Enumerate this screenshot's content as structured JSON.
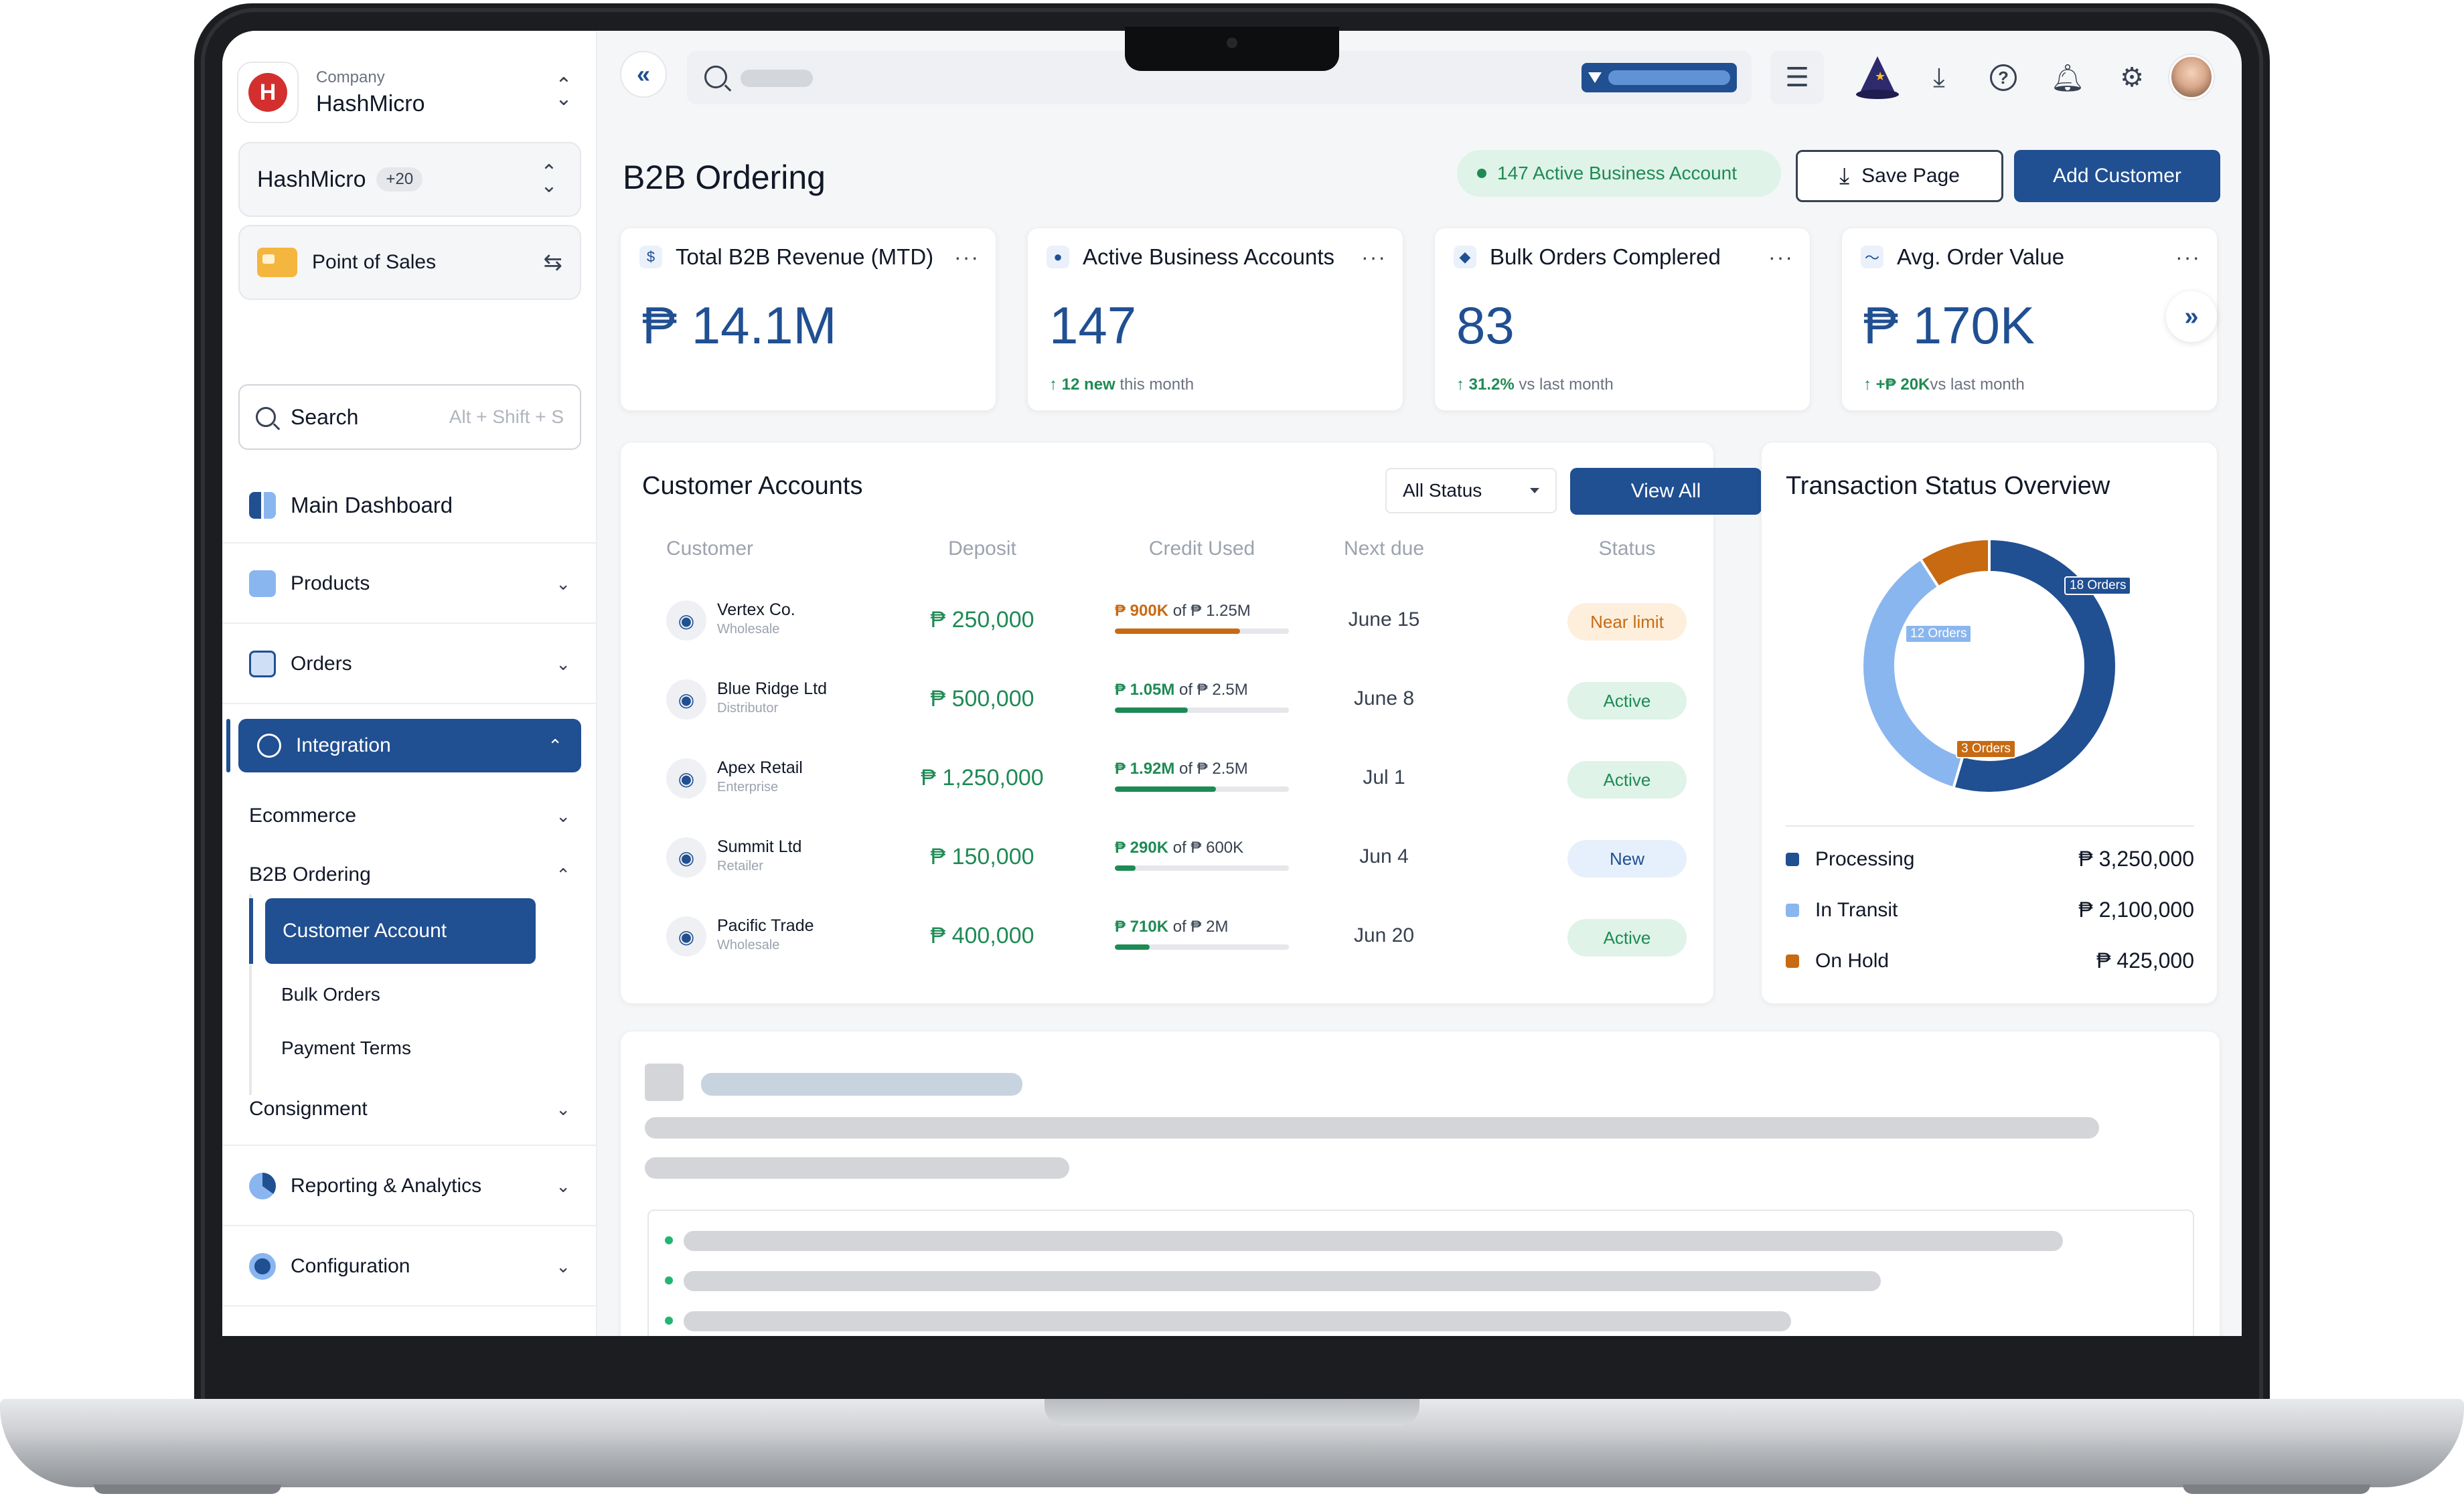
{
  "colors": {
    "brand": "#204f92",
    "success": "#1f8a55",
    "warning": "#c76a12",
    "processing": "#204f92",
    "in_transit": "#8ab6ef",
    "on_hold": "#c76a12"
  },
  "sidebar": {
    "company_label": "Company",
    "company_name": "HashMicro",
    "brand_name": "HashMicro",
    "brand_count": "+20",
    "module_name": "Point of Sales",
    "search_label": "Search",
    "search_shortcut": "Alt + Shift + S",
    "nav": {
      "main_dashboard": "Main Dashboard",
      "products": "Products",
      "orders": "Orders",
      "integration": "Integration",
      "ecommerce": "Ecommerce",
      "b2b_ordering": "B2B Ordering",
      "customer_account": "Customer Account",
      "bulk_orders": "Bulk Orders",
      "payment_terms": "Payment Terms",
      "consignment": "Consignment",
      "reporting": "Reporting & Analytics",
      "configuration": "Configuration"
    }
  },
  "header": {
    "icons": [
      "collapse-icon",
      "search-icon",
      "filter-icon",
      "sliders-icon",
      "wizard-icon",
      "download-icon",
      "help-icon",
      "bell-icon",
      "gear-icon"
    ]
  },
  "page": {
    "title": "B2B Ordering",
    "active_pill": "147 Active Business Account",
    "save_button": "Save Page",
    "add_button": "Add Customer"
  },
  "kpis": [
    {
      "title": "Total B2B Revenue (MTD)",
      "value": "₱ 14.1M",
      "delta_strong": "",
      "delta_text": ""
    },
    {
      "title": "Active Business Accounts",
      "value": "147",
      "delta_strong": "↑ 12 new",
      "delta_text": " this month"
    },
    {
      "title": "Bulk Orders Complered",
      "value": "83",
      "delta_strong": "↑ 31.2%",
      "delta_text": " vs last month"
    },
    {
      "title": "Avg. Order Value",
      "value": "₱ 170K",
      "delta_strong": "↑ +₱ 20K",
      "delta_text": "vs last month"
    }
  ],
  "customers": {
    "title": "Customer Accounts",
    "filter_value": "All Status",
    "view_all": "View All",
    "columns": [
      "Customer",
      "Deposit",
      "Credit Used",
      "Next due",
      "Status"
    ],
    "rows": [
      {
        "name": "Vertex Co.",
        "type": "Wholesale",
        "deposit": "₱ 250,000",
        "used": "₱ 900K",
        "limit": " of ₱ 1.25M",
        "pct": 0.72,
        "due": "June 15",
        "status": "Near limit",
        "tone": "warn"
      },
      {
        "name": "Blue Ridge Ltd",
        "type": "Distributor",
        "deposit": "₱ 500,000",
        "used": "₱ 1.05M",
        "limit": " of ₱ 2.5M",
        "pct": 0.42,
        "due": "June 8",
        "status": "Active",
        "tone": "ok"
      },
      {
        "name": "Apex Retail",
        "type": "Enterprise",
        "deposit": "₱ 1,250,000",
        "used": "₱ 1.92M",
        "limit": " of ₱ 2.5M",
        "pct": 0.58,
        "due": "Jul 1",
        "status": "Active",
        "tone": "ok"
      },
      {
        "name": "Summit Ltd",
        "type": "Retailer",
        "deposit": "₱ 150,000",
        "used": "₱ 290K",
        "limit": " of ₱ 600K",
        "pct": 0.12,
        "due": "Jun 4",
        "status": "New",
        "tone": "new"
      },
      {
        "name": "Pacific Trade",
        "type": "Wholesale",
        "deposit": "₱ 400,000",
        "used": "₱ 710K",
        "limit": " of ₱ 2M",
        "pct": 0.2,
        "due": "Jun 20",
        "status": "Active",
        "tone": "ok"
      }
    ]
  },
  "transactions": {
    "title": "Transaction Status Overview",
    "chart_data": {
      "type": "pie",
      "categories": [
        "Processing",
        "In Transit",
        "On Hold"
      ],
      "values": [
        18,
        12,
        3
      ],
      "labels": [
        "18 Orders",
        "12 Orders",
        "3 Orders"
      ]
    },
    "legend": [
      {
        "label": "Processing",
        "amount": "₱ 3,250,000",
        "color": "#204f92"
      },
      {
        "label": "In Transit",
        "amount": "₱ 2,100,000",
        "color": "#8ab6ef"
      },
      {
        "label": "On Hold",
        "amount": "₱ 425,000",
        "color": "#c76a12"
      }
    ]
  }
}
